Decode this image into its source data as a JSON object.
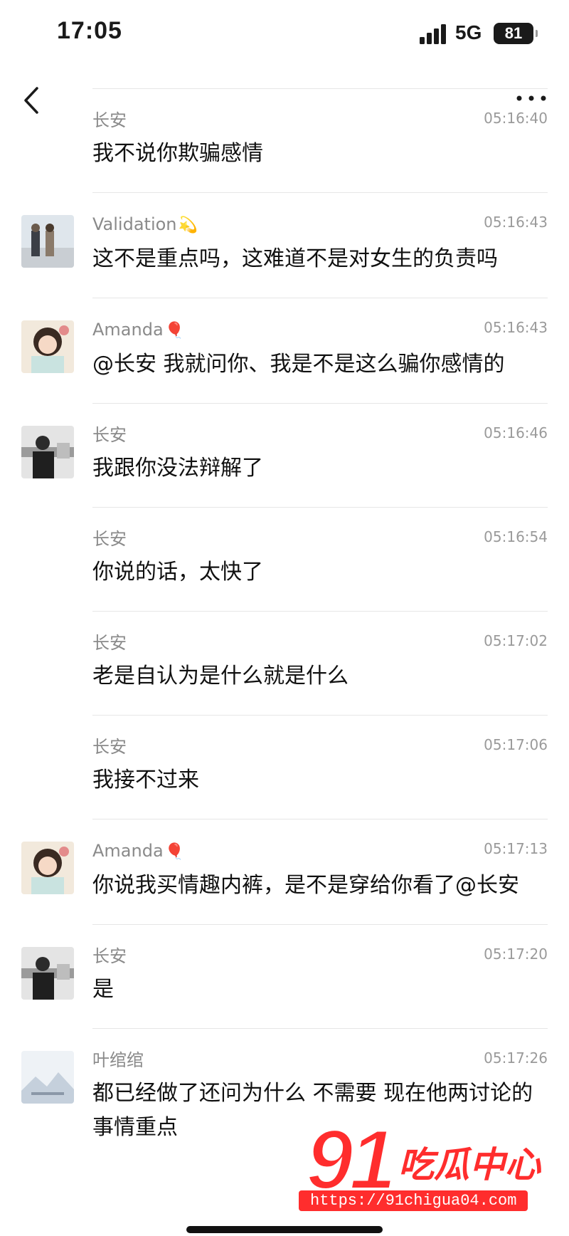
{
  "status": {
    "time": "17:05",
    "network": "5G",
    "battery": "81"
  },
  "icons": {
    "back": "chevron-left-icon",
    "more": "more-horizontal-icon",
    "signal": "signal-bars-icon",
    "battery": "battery-icon"
  },
  "messages": [
    {
      "sender": "长安",
      "emoji": "",
      "time": "05:16:40",
      "text": "我不说你欺骗感情",
      "avatar": "none"
    },
    {
      "sender": "Validation",
      "emoji": "💫",
      "time": "05:16:43",
      "text": "这不是重点吗，这难道不是对女生的负责吗",
      "avatar": "photo-couple"
    },
    {
      "sender": "Amanda",
      "emoji": "🎈",
      "time": "05:16:43",
      "text": "@长安 我就问你、我是不是这么骗你感情的",
      "avatar": "photo-girl"
    },
    {
      "sender": "长安",
      "emoji": "",
      "time": "05:16:46",
      "text": "我跟你没法辩解了",
      "avatar": "photo-man"
    },
    {
      "sender": "长安",
      "emoji": "",
      "time": "05:16:54",
      "text": "你说的话，太快了",
      "avatar": "none"
    },
    {
      "sender": "长安",
      "emoji": "",
      "time": "05:17:02",
      "text": "老是自认为是什么就是什么",
      "avatar": "none"
    },
    {
      "sender": "长安",
      "emoji": "",
      "time": "05:17:06",
      "text": "我接不过来",
      "avatar": "none"
    },
    {
      "sender": "Amanda",
      "emoji": "🎈",
      "time": "05:17:13",
      "text": "你说我买情趣内裤，是不是穿给你看了@长安",
      "avatar": "photo-girl"
    },
    {
      "sender": "长安",
      "emoji": "",
      "time": "05:17:20",
      "text": "是",
      "avatar": "photo-man"
    },
    {
      "sender": "叶绾绾",
      "emoji": "",
      "time": "05:17:26",
      "text": "都已经做了还问为什么 不需要 现在他两讨论的事情重点",
      "avatar": "photo-landscape"
    }
  ],
  "watermark": {
    "number": "91",
    "title": "吃瓜中心",
    "url": "https://91chigua04.com"
  },
  "colors": {
    "accent": "#ff2d2d",
    "divider": "#e6e6e6",
    "meta": "#8a8a8a"
  }
}
